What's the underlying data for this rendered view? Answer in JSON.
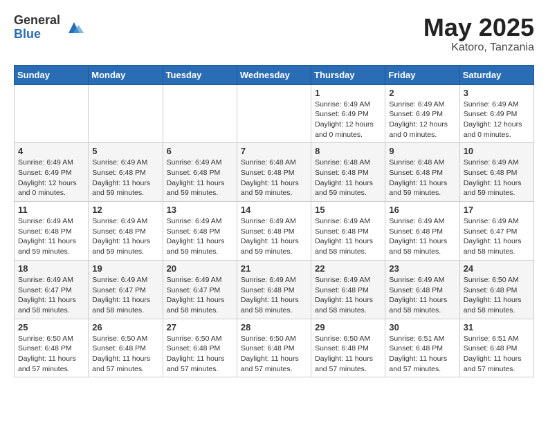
{
  "logo": {
    "general": "General",
    "blue": "Blue"
  },
  "title": "May 2025",
  "location": "Katoro, Tanzania",
  "days_of_week": [
    "Sunday",
    "Monday",
    "Tuesday",
    "Wednesday",
    "Thursday",
    "Friday",
    "Saturday"
  ],
  "weeks": [
    [
      {
        "day": "",
        "info": ""
      },
      {
        "day": "",
        "info": ""
      },
      {
        "day": "",
        "info": ""
      },
      {
        "day": "",
        "info": ""
      },
      {
        "day": "1",
        "info": "Sunrise: 6:49 AM\nSunset: 6:49 PM\nDaylight: 12 hours and 0 minutes."
      },
      {
        "day": "2",
        "info": "Sunrise: 6:49 AM\nSunset: 6:49 PM\nDaylight: 12 hours and 0 minutes."
      },
      {
        "day": "3",
        "info": "Sunrise: 6:49 AM\nSunset: 6:49 PM\nDaylight: 12 hours and 0 minutes."
      }
    ],
    [
      {
        "day": "4",
        "info": "Sunrise: 6:49 AM\nSunset: 6:49 PM\nDaylight: 12 hours and 0 minutes."
      },
      {
        "day": "5",
        "info": "Sunrise: 6:49 AM\nSunset: 6:48 PM\nDaylight: 11 hours and 59 minutes."
      },
      {
        "day": "6",
        "info": "Sunrise: 6:49 AM\nSunset: 6:48 PM\nDaylight: 11 hours and 59 minutes."
      },
      {
        "day": "7",
        "info": "Sunrise: 6:48 AM\nSunset: 6:48 PM\nDaylight: 11 hours and 59 minutes."
      },
      {
        "day": "8",
        "info": "Sunrise: 6:48 AM\nSunset: 6:48 PM\nDaylight: 11 hours and 59 minutes."
      },
      {
        "day": "9",
        "info": "Sunrise: 6:48 AM\nSunset: 6:48 PM\nDaylight: 11 hours and 59 minutes."
      },
      {
        "day": "10",
        "info": "Sunrise: 6:49 AM\nSunset: 6:48 PM\nDaylight: 11 hours and 59 minutes."
      }
    ],
    [
      {
        "day": "11",
        "info": "Sunrise: 6:49 AM\nSunset: 6:48 PM\nDaylight: 11 hours and 59 minutes."
      },
      {
        "day": "12",
        "info": "Sunrise: 6:49 AM\nSunset: 6:48 PM\nDaylight: 11 hours and 59 minutes."
      },
      {
        "day": "13",
        "info": "Sunrise: 6:49 AM\nSunset: 6:48 PM\nDaylight: 11 hours and 59 minutes."
      },
      {
        "day": "14",
        "info": "Sunrise: 6:49 AM\nSunset: 6:48 PM\nDaylight: 11 hours and 59 minutes."
      },
      {
        "day": "15",
        "info": "Sunrise: 6:49 AM\nSunset: 6:48 PM\nDaylight: 11 hours and 58 minutes."
      },
      {
        "day": "16",
        "info": "Sunrise: 6:49 AM\nSunset: 6:48 PM\nDaylight: 11 hours and 58 minutes."
      },
      {
        "day": "17",
        "info": "Sunrise: 6:49 AM\nSunset: 6:47 PM\nDaylight: 11 hours and 58 minutes."
      }
    ],
    [
      {
        "day": "18",
        "info": "Sunrise: 6:49 AM\nSunset: 6:47 PM\nDaylight: 11 hours and 58 minutes."
      },
      {
        "day": "19",
        "info": "Sunrise: 6:49 AM\nSunset: 6:47 PM\nDaylight: 11 hours and 58 minutes."
      },
      {
        "day": "20",
        "info": "Sunrise: 6:49 AM\nSunset: 6:47 PM\nDaylight: 11 hours and 58 minutes."
      },
      {
        "day": "21",
        "info": "Sunrise: 6:49 AM\nSunset: 6:48 PM\nDaylight: 11 hours and 58 minutes."
      },
      {
        "day": "22",
        "info": "Sunrise: 6:49 AM\nSunset: 6:48 PM\nDaylight: 11 hours and 58 minutes."
      },
      {
        "day": "23",
        "info": "Sunrise: 6:49 AM\nSunset: 6:48 PM\nDaylight: 11 hours and 58 minutes."
      },
      {
        "day": "24",
        "info": "Sunrise: 6:50 AM\nSunset: 6:48 PM\nDaylight: 11 hours and 58 minutes."
      }
    ],
    [
      {
        "day": "25",
        "info": "Sunrise: 6:50 AM\nSunset: 6:48 PM\nDaylight: 11 hours and 57 minutes."
      },
      {
        "day": "26",
        "info": "Sunrise: 6:50 AM\nSunset: 6:48 PM\nDaylight: 11 hours and 57 minutes."
      },
      {
        "day": "27",
        "info": "Sunrise: 6:50 AM\nSunset: 6:48 PM\nDaylight: 11 hours and 57 minutes."
      },
      {
        "day": "28",
        "info": "Sunrise: 6:50 AM\nSunset: 6:48 PM\nDaylight: 11 hours and 57 minutes."
      },
      {
        "day": "29",
        "info": "Sunrise: 6:50 AM\nSunset: 6:48 PM\nDaylight: 11 hours and 57 minutes."
      },
      {
        "day": "30",
        "info": "Sunrise: 6:51 AM\nSunset: 6:48 PM\nDaylight: 11 hours and 57 minutes."
      },
      {
        "day": "31",
        "info": "Sunrise: 6:51 AM\nSunset: 6:48 PM\nDaylight: 11 hours and 57 minutes."
      }
    ]
  ]
}
